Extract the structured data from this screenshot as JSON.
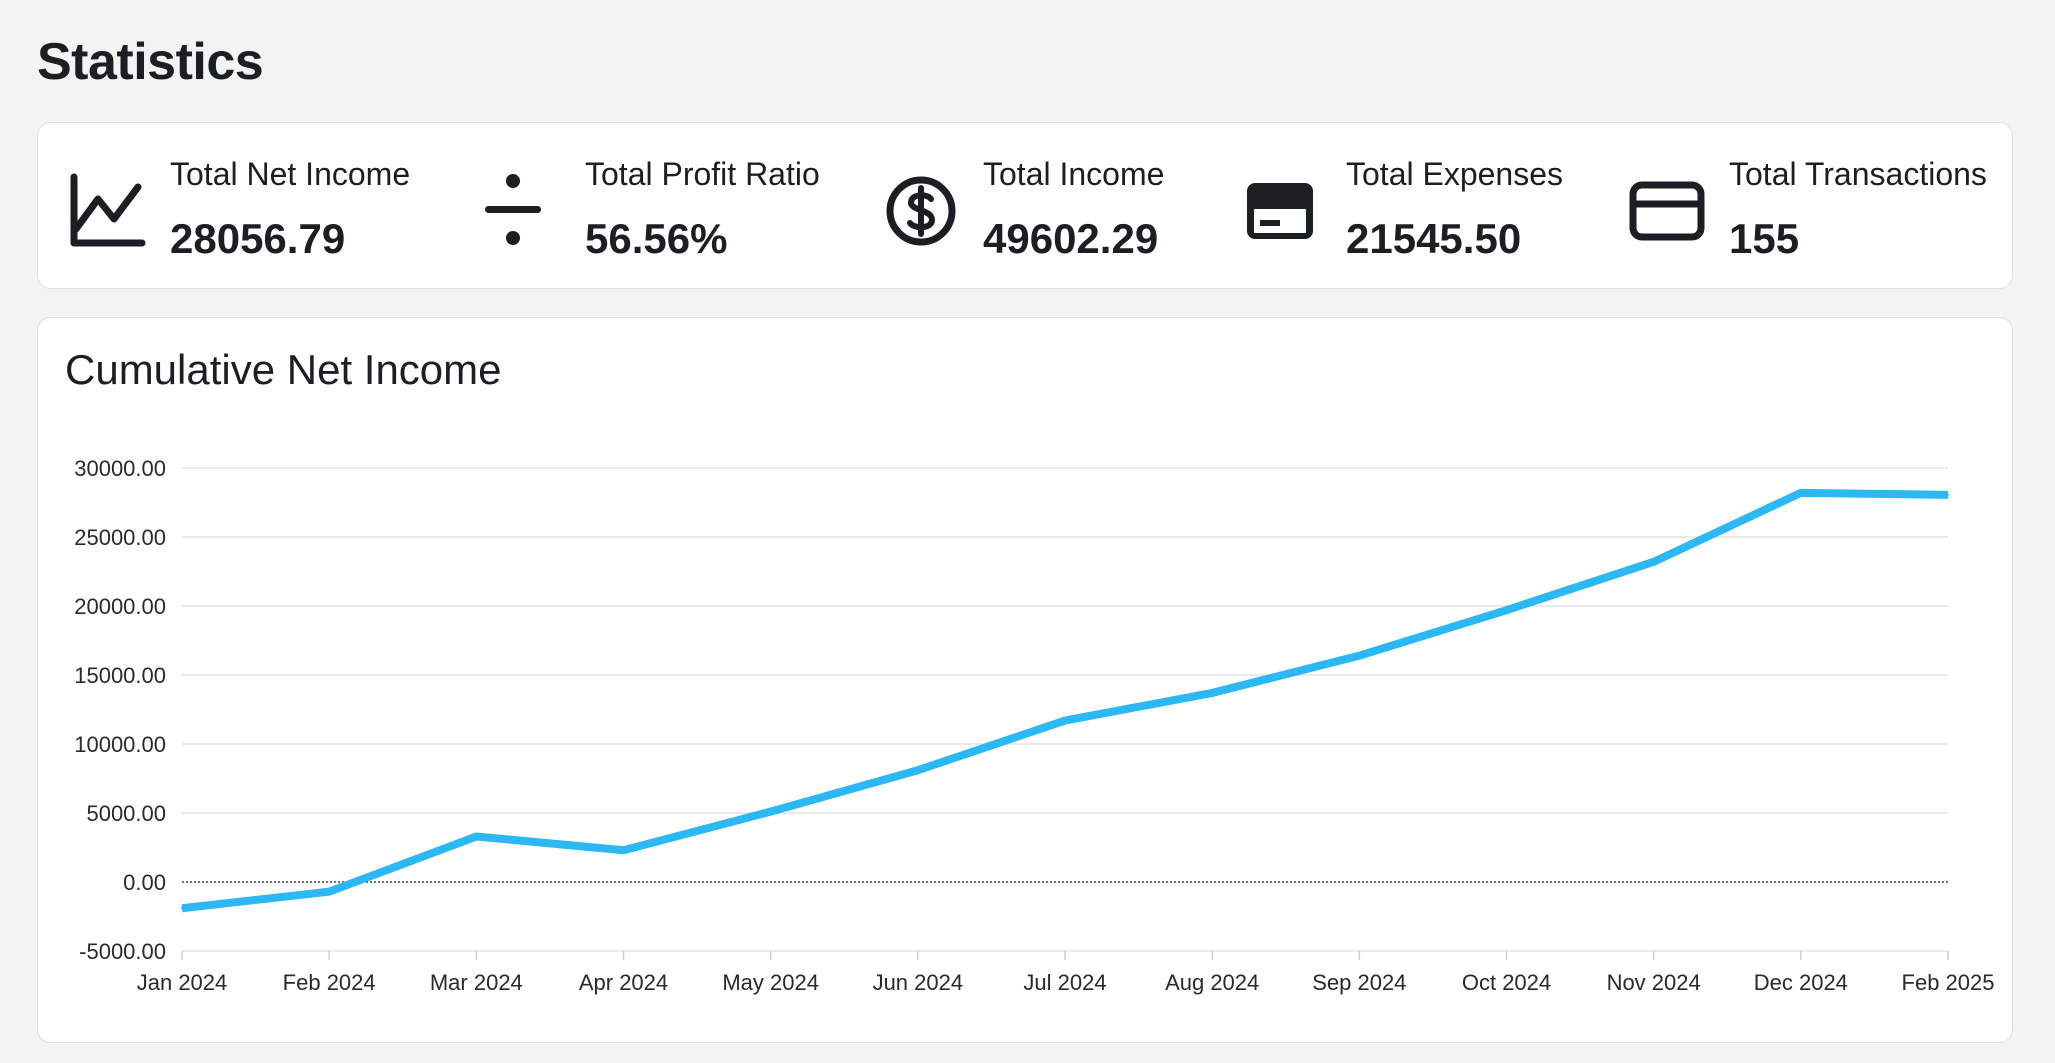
{
  "page": {
    "title": "Statistics"
  },
  "stats": [
    {
      "label": "Total Net Income",
      "value": "28056.79",
      "icon": "trending-chart-icon"
    },
    {
      "label": "Total Profit Ratio",
      "value": "56.56%",
      "icon": "divide-icon"
    },
    {
      "label": "Total Income",
      "value": "49602.29",
      "icon": "dollar-circle-icon"
    },
    {
      "label": "Total Expenses",
      "value": "21545.50",
      "icon": "credit-card-filled-icon"
    },
    {
      "label": "Total Transactions",
      "value": "155",
      "icon": "credit-card-outline-icon"
    }
  ],
  "chart_title": "Cumulative Net Income",
  "chart_data": {
    "type": "line",
    "title": "Cumulative Net Income",
    "categories": [
      "Jan 2024",
      "Feb 2024",
      "Mar 2024",
      "Apr 2024",
      "May 2024",
      "Jun 2024",
      "Jul 2024",
      "Aug 2024",
      "Sep 2024",
      "Oct 2024",
      "Nov 2024",
      "Dec 2024",
      "Feb 2025"
    ],
    "series": [
      {
        "values": [
          -1900,
          -700,
          3300,
          2300,
          5100,
          8100,
          11700,
          13700,
          16400,
          19700,
          23200,
          28200,
          28056.79
        ]
      }
    ],
    "y_ticks": [
      "-5000.00",
      "0.00",
      "5000.00",
      "10000.00",
      "15000.00",
      "20000.00",
      "25000.00",
      "30000.00"
    ],
    "ylim": [
      -5000,
      30000
    ],
    "grid": true,
    "zero_line": true,
    "line_color": "#2bb8f5"
  }
}
